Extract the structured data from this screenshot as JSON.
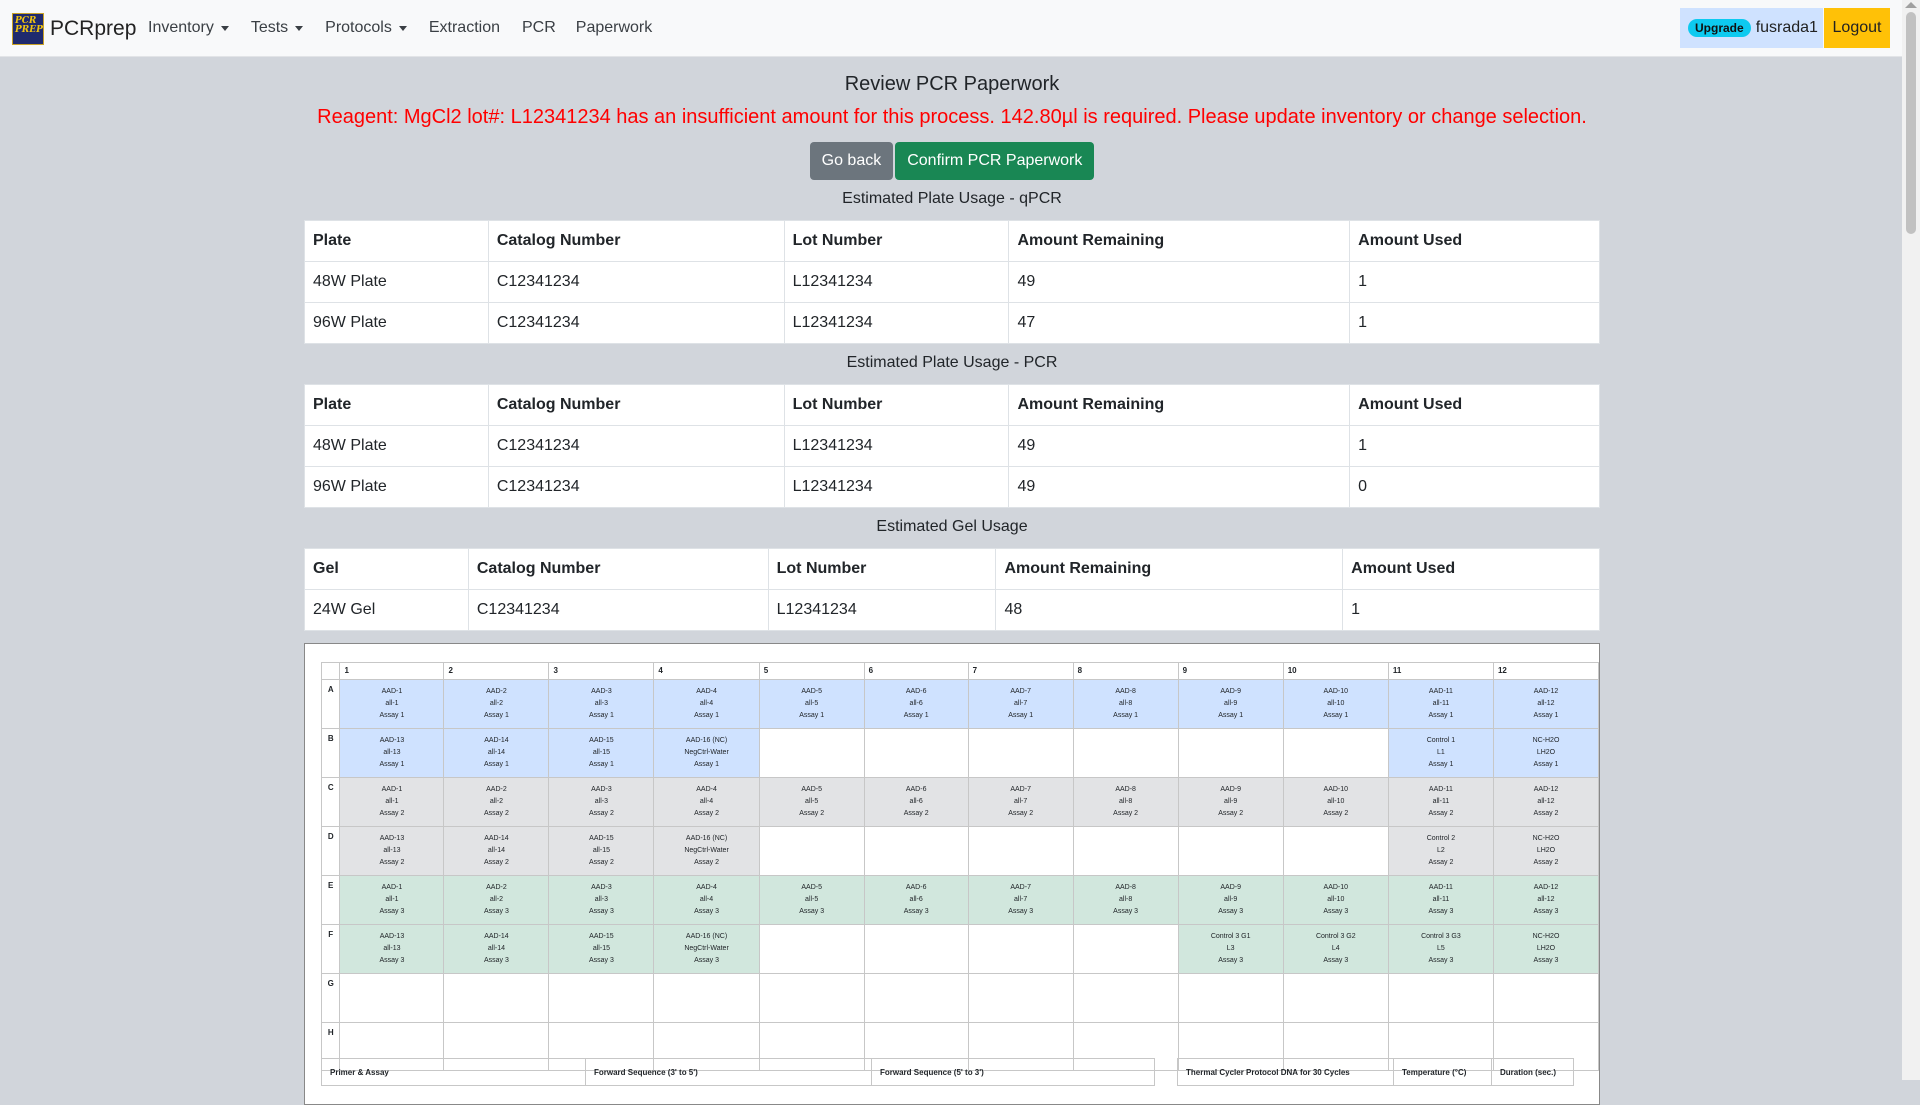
{
  "navbar": {
    "brand": "PCRprep",
    "logo_text": "PCR PREP",
    "items": [
      {
        "label": "Inventory",
        "dropdown": true
      },
      {
        "label": "Tests",
        "dropdown": true
      },
      {
        "label": "Protocols",
        "dropdown": true
      },
      {
        "label": "Extraction",
        "dropdown": false
      },
      {
        "label": "PCR",
        "dropdown": false
      },
      {
        "label": "Paperwork",
        "dropdown": false
      }
    ],
    "upgrade_badge": "Upgrade",
    "username": "fusrada1",
    "logout": "Logout"
  },
  "page": {
    "title": "Review PCR Paperwork",
    "alert": "Reagent: MgCl2 lot#: L12341234 has an insufficient amount for this process. 142.80µl is required. Please update inventory or change selection.",
    "go_back": "Go back",
    "confirm": "Confirm PCR Paperwork"
  },
  "qpcr_usage": {
    "title": "Estimated Plate Usage - qPCR",
    "headers": [
      "Plate",
      "Catalog Number",
      "Lot Number",
      "Amount Remaining",
      "Amount Used"
    ],
    "rows": [
      [
        "48W Plate",
        "C12341234",
        "L12341234",
        "49",
        "1"
      ],
      [
        "96W Plate",
        "C12341234",
        "L12341234",
        "47",
        "1"
      ]
    ]
  },
  "pcr_usage": {
    "title": "Estimated Plate Usage - PCR",
    "headers": [
      "Plate",
      "Catalog Number",
      "Lot Number",
      "Amount Remaining",
      "Amount Used"
    ],
    "rows": [
      [
        "48W Plate",
        "C12341234",
        "L12341234",
        "49",
        "1"
      ],
      [
        "96W Plate",
        "C12341234",
        "L12341234",
        "49",
        "0"
      ]
    ]
  },
  "gel_usage": {
    "title": "Estimated Gel Usage",
    "headers": [
      "Gel",
      "Catalog Number",
      "Lot Number",
      "Amount Remaining",
      "Amount Used"
    ],
    "rows": [
      [
        "24W Gel",
        "C12341234",
        "L12341234",
        "48",
        "1"
      ]
    ]
  },
  "plate_map": {
    "columns": [
      "1",
      "2",
      "3",
      "4",
      "5",
      "6",
      "7",
      "8",
      "9",
      "10",
      "11",
      "12"
    ],
    "rows": [
      {
        "label": "A",
        "color": "#cfe2ff",
        "wells": [
          "AAD-1|all-1|Assay 1",
          "AAD-2|all-2|Assay 1",
          "AAD-3|all-3|Assay 1",
          "AAD-4|all-4|Assay 1",
          "AAD-5|all-5|Assay 1",
          "AAD-6|all-6|Assay 1",
          "AAD-7|all-7|Assay 1",
          "AAD-8|all-8|Assay 1",
          "AAD-9|all-9|Assay 1",
          "AAD-10|all-10|Assay 1",
          "AAD-11|all-11|Assay 1",
          "AAD-12|all-12|Assay 1"
        ]
      },
      {
        "label": "B",
        "color": "#cfe2ff",
        "wells": [
          "AAD-13|all-13|Assay 1",
          "AAD-14|all-14|Assay 1",
          "AAD-15|all-15|Assay 1",
          "AAD-16 (NC)|NegCtrl-Water|Assay 1",
          "",
          "",
          "",
          "",
          "",
          "",
          "Control 1|L1|Assay 1",
          "NC-H2O|LH2O|Assay 1"
        ]
      },
      {
        "label": "C",
        "color": "#e2e3e5",
        "wells": [
          "AAD-1|all-1|Assay 2",
          "AAD-2|all-2|Assay 2",
          "AAD-3|all-3|Assay 2",
          "AAD-4|all-4|Assay 2",
          "AAD-5|all-5|Assay 2",
          "AAD-6|all-6|Assay 2",
          "AAD-7|all-7|Assay 2",
          "AAD-8|all-8|Assay 2",
          "AAD-9|all-9|Assay 2",
          "AAD-10|all-10|Assay 2",
          "AAD-11|all-11|Assay 2",
          "AAD-12|all-12|Assay 2"
        ]
      },
      {
        "label": "D",
        "color": "#e2e3e5",
        "wells": [
          "AAD-13|all-13|Assay 2",
          "AAD-14|all-14|Assay 2",
          "AAD-15|all-15|Assay 2",
          "AAD-16 (NC)|NegCtrl-Water|Assay 2",
          "",
          "",
          "",
          "",
          "",
          "",
          "Control 2|L2|Assay 2",
          "NC-H2O|LH2O|Assay 2"
        ]
      },
      {
        "label": "E",
        "color": "#d1e7dd",
        "wells": [
          "AAD-1|all-1|Assay 3",
          "AAD-2|all-2|Assay 3",
          "AAD-3|all-3|Assay 3",
          "AAD-4|all-4|Assay 3",
          "AAD-5|all-5|Assay 3",
          "AAD-6|all-6|Assay 3",
          "AAD-7|all-7|Assay 3",
          "AAD-8|all-8|Assay 3",
          "AAD-9|all-9|Assay 3",
          "AAD-10|all-10|Assay 3",
          "AAD-11|all-11|Assay 3",
          "AAD-12|all-12|Assay 3"
        ]
      },
      {
        "label": "F",
        "color": "#d1e7dd",
        "wells": [
          "AAD-13|all-13|Assay 3",
          "AAD-14|all-14|Assay 3",
          "AAD-15|all-15|Assay 3",
          "AAD-16 (NC)|NegCtrl-Water|Assay 3",
          "",
          "",
          "",
          "",
          "Control 3 G1|L3|Assay 3",
          "Control 3 G2|L4|Assay 3",
          "Control 3 G3|L5|Assay 3",
          "NC-H2O|LH2O|Assay 3"
        ]
      },
      {
        "label": "G",
        "color": "",
        "wells": [
          "",
          "",
          "",
          "",
          "",
          "",
          "",
          "",
          "",
          "",
          "",
          ""
        ]
      },
      {
        "label": "H",
        "color": "",
        "wells": [
          "",
          "",
          "",
          "",
          "",
          "",
          "",
          "",
          "",
          "",
          "",
          ""
        ]
      }
    ]
  },
  "primer_table": {
    "headers": [
      "Primer & Assay",
      "Forward Sequence (3' to 5')",
      "Forward Sequence (5' to 3')"
    ]
  },
  "thermal_table": {
    "headers": [
      "Thermal Cycler Protocol DNA for 30 Cycles",
      "Temperature (°C)",
      "Duration (sec.)"
    ]
  }
}
